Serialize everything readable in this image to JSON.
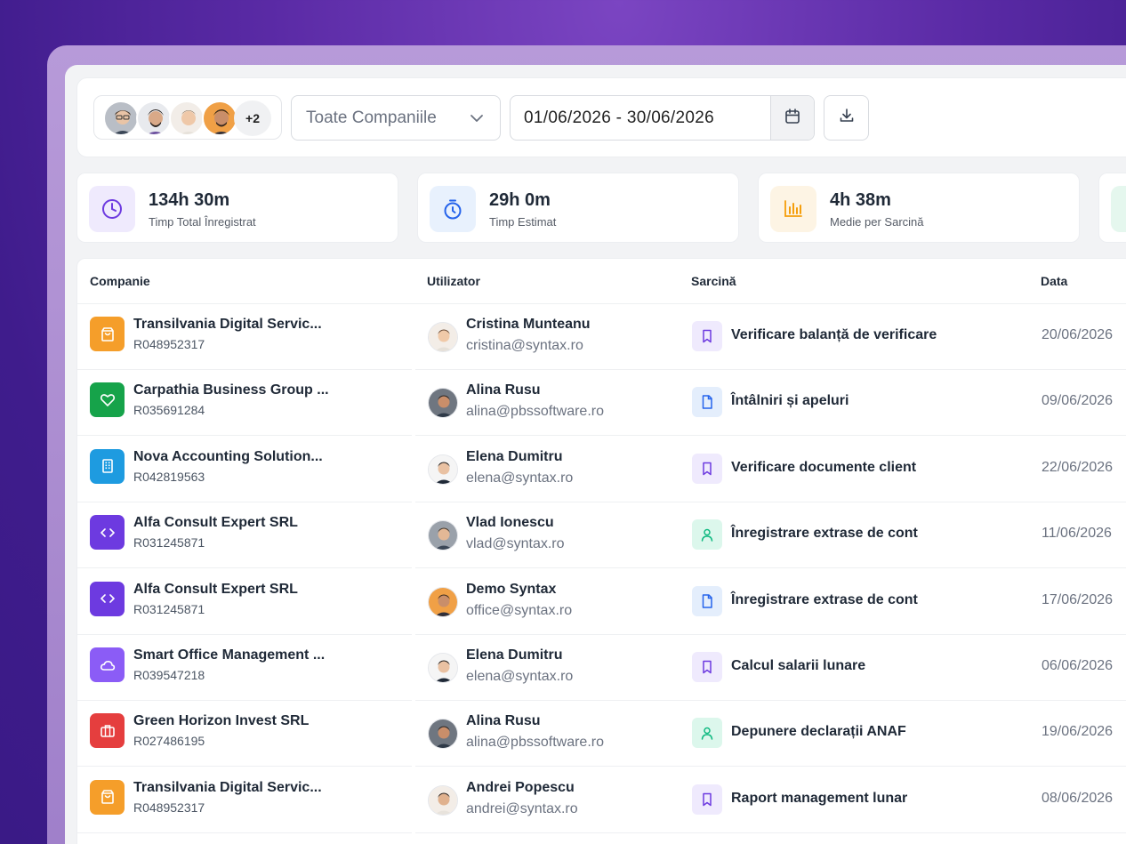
{
  "filters": {
    "avatar_overflow": "+2",
    "company_select": "Toate Companiile",
    "date_range": "01/06/2026 - 30/06/2026"
  },
  "stats": [
    {
      "value": "134h 30m",
      "label": "Timp Total Înregistrat",
      "icon": "clock-icon",
      "color": "#7c3aed"
    },
    {
      "value": "29h 0m",
      "label": "Timp Estimat",
      "icon": "stopwatch-icon",
      "color": "#2563eb"
    },
    {
      "value": "4h 38m",
      "label": "Medie per Sarcină",
      "icon": "bar-chart-icon",
      "color": "#f59e0b"
    }
  ],
  "table": {
    "headers": {
      "company": "Companie",
      "user": "Utilizator",
      "task": "Sarcină",
      "date": "Data"
    },
    "rows": [
      {
        "company": "Transilvania Digital Servic...",
        "code": "R048952317",
        "company_icon": "shopping-bag-icon",
        "company_color": "#f59e2a",
        "user": "Cristina Munteanu",
        "email": "cristina@syntax.ro",
        "task": "Verificare balanță de verificare",
        "task_icon": "bookmark-icon",
        "date": "20/06/2026"
      },
      {
        "company": "Carpathia Business Group ...",
        "code": "R035691284",
        "company_icon": "heart-icon",
        "company_color": "#16a34a",
        "user": "Alina Rusu",
        "email": "alina@pbssoftware.ro",
        "task": "Întâlniri și apeluri",
        "task_icon": "document-icon",
        "date": "09/06/2026"
      },
      {
        "company": "Nova Accounting Solution...",
        "code": "R042819563",
        "company_icon": "building-icon",
        "company_color": "#1e9be0",
        "user": "Elena Dumitru",
        "email": "elena@syntax.ro",
        "task": "Verificare documente client",
        "task_icon": "bookmark-icon",
        "date": "22/06/2026"
      },
      {
        "company": "Alfa Consult Expert SRL",
        "code": "R031245871",
        "company_icon": "code-icon",
        "company_color": "#6d3ae0",
        "user": "Vlad Ionescu",
        "email": "vlad@syntax.ro",
        "task": "Înregistrare extrase de cont",
        "task_icon": "user-icon",
        "date": "11/06/2026"
      },
      {
        "company": "Alfa Consult Expert SRL",
        "code": "R031245871",
        "company_icon": "code-icon",
        "company_color": "#6d3ae0",
        "user": "Demo Syntax",
        "email": "office@syntax.ro",
        "task": "Înregistrare extrase de cont",
        "task_icon": "document-icon",
        "date": "17/06/2026"
      },
      {
        "company": "Smart Office Management ...",
        "code": "R039547218",
        "company_icon": "cloud-icon",
        "company_color": "#8b5cf6",
        "user": "Elena Dumitru",
        "email": "elena@syntax.ro",
        "task": "Calcul salarii lunare",
        "task_icon": "bookmark-icon",
        "date": "06/06/2026"
      },
      {
        "company": "Green Horizon Invest SRL",
        "code": "R027486195",
        "company_icon": "briefcase-icon",
        "company_color": "#e53e3e",
        "user": "Alina Rusu",
        "email": "alina@pbssoftware.ro",
        "task": "Depunere declarații ANAF",
        "task_icon": "user-icon",
        "date": "19/06/2026"
      },
      {
        "company": "Transilvania Digital Servic...",
        "code": "R048952317",
        "company_icon": "shopping-bag-icon",
        "company_color": "#f59e2a",
        "user": "Andrei Popescu",
        "email": "andrei@syntax.ro",
        "task": "Raport management lunar",
        "task_icon": "bookmark-icon",
        "date": "08/06/2026"
      }
    ]
  }
}
